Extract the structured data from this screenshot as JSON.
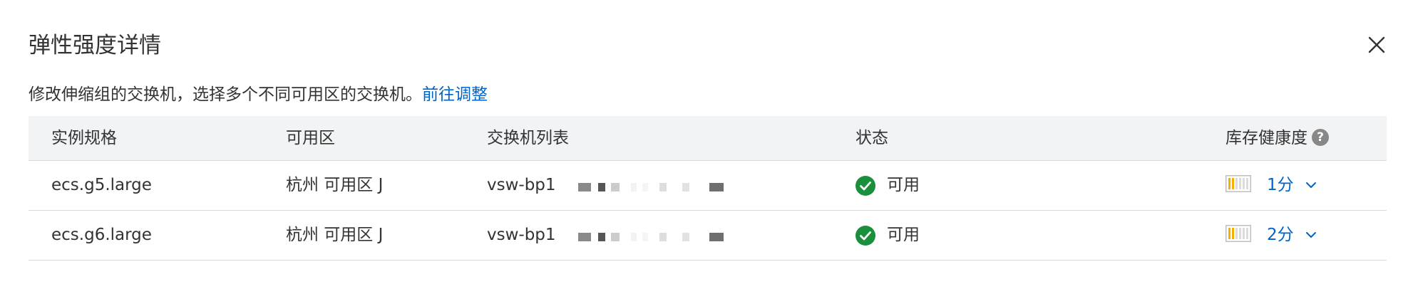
{
  "dialog": {
    "title": "弹性强度详情",
    "description": "修改伸缩组的交换机，选择多个不同可用区的交换机。",
    "link_label": "前往调整"
  },
  "table": {
    "headers": {
      "spec": "实例规格",
      "zone": "可用区",
      "vswitch": "交换机列表",
      "status": "状态",
      "health": "库存健康度",
      "help": "?"
    },
    "rows": [
      {
        "spec": "ecs.g5.large",
        "zone": "杭州 可用区 J",
        "vswitch": "vsw-bp1",
        "status": "可用",
        "health_score": "1分"
      },
      {
        "spec": "ecs.g6.large",
        "zone": "杭州 可用区 J",
        "vswitch": "vsw-bp1",
        "status": "可用",
        "health_score": "2分"
      }
    ]
  },
  "colors": {
    "link": "#0064c8",
    "status_ok": "#1a8f3c",
    "health_fill": "#f6b100",
    "header_bg": "#f2f3f5"
  },
  "icons": {
    "close": "close-icon",
    "help": "help-icon",
    "status": "check-circle-icon",
    "health": "health-bar-icon",
    "expand": "chevron-down-icon"
  }
}
